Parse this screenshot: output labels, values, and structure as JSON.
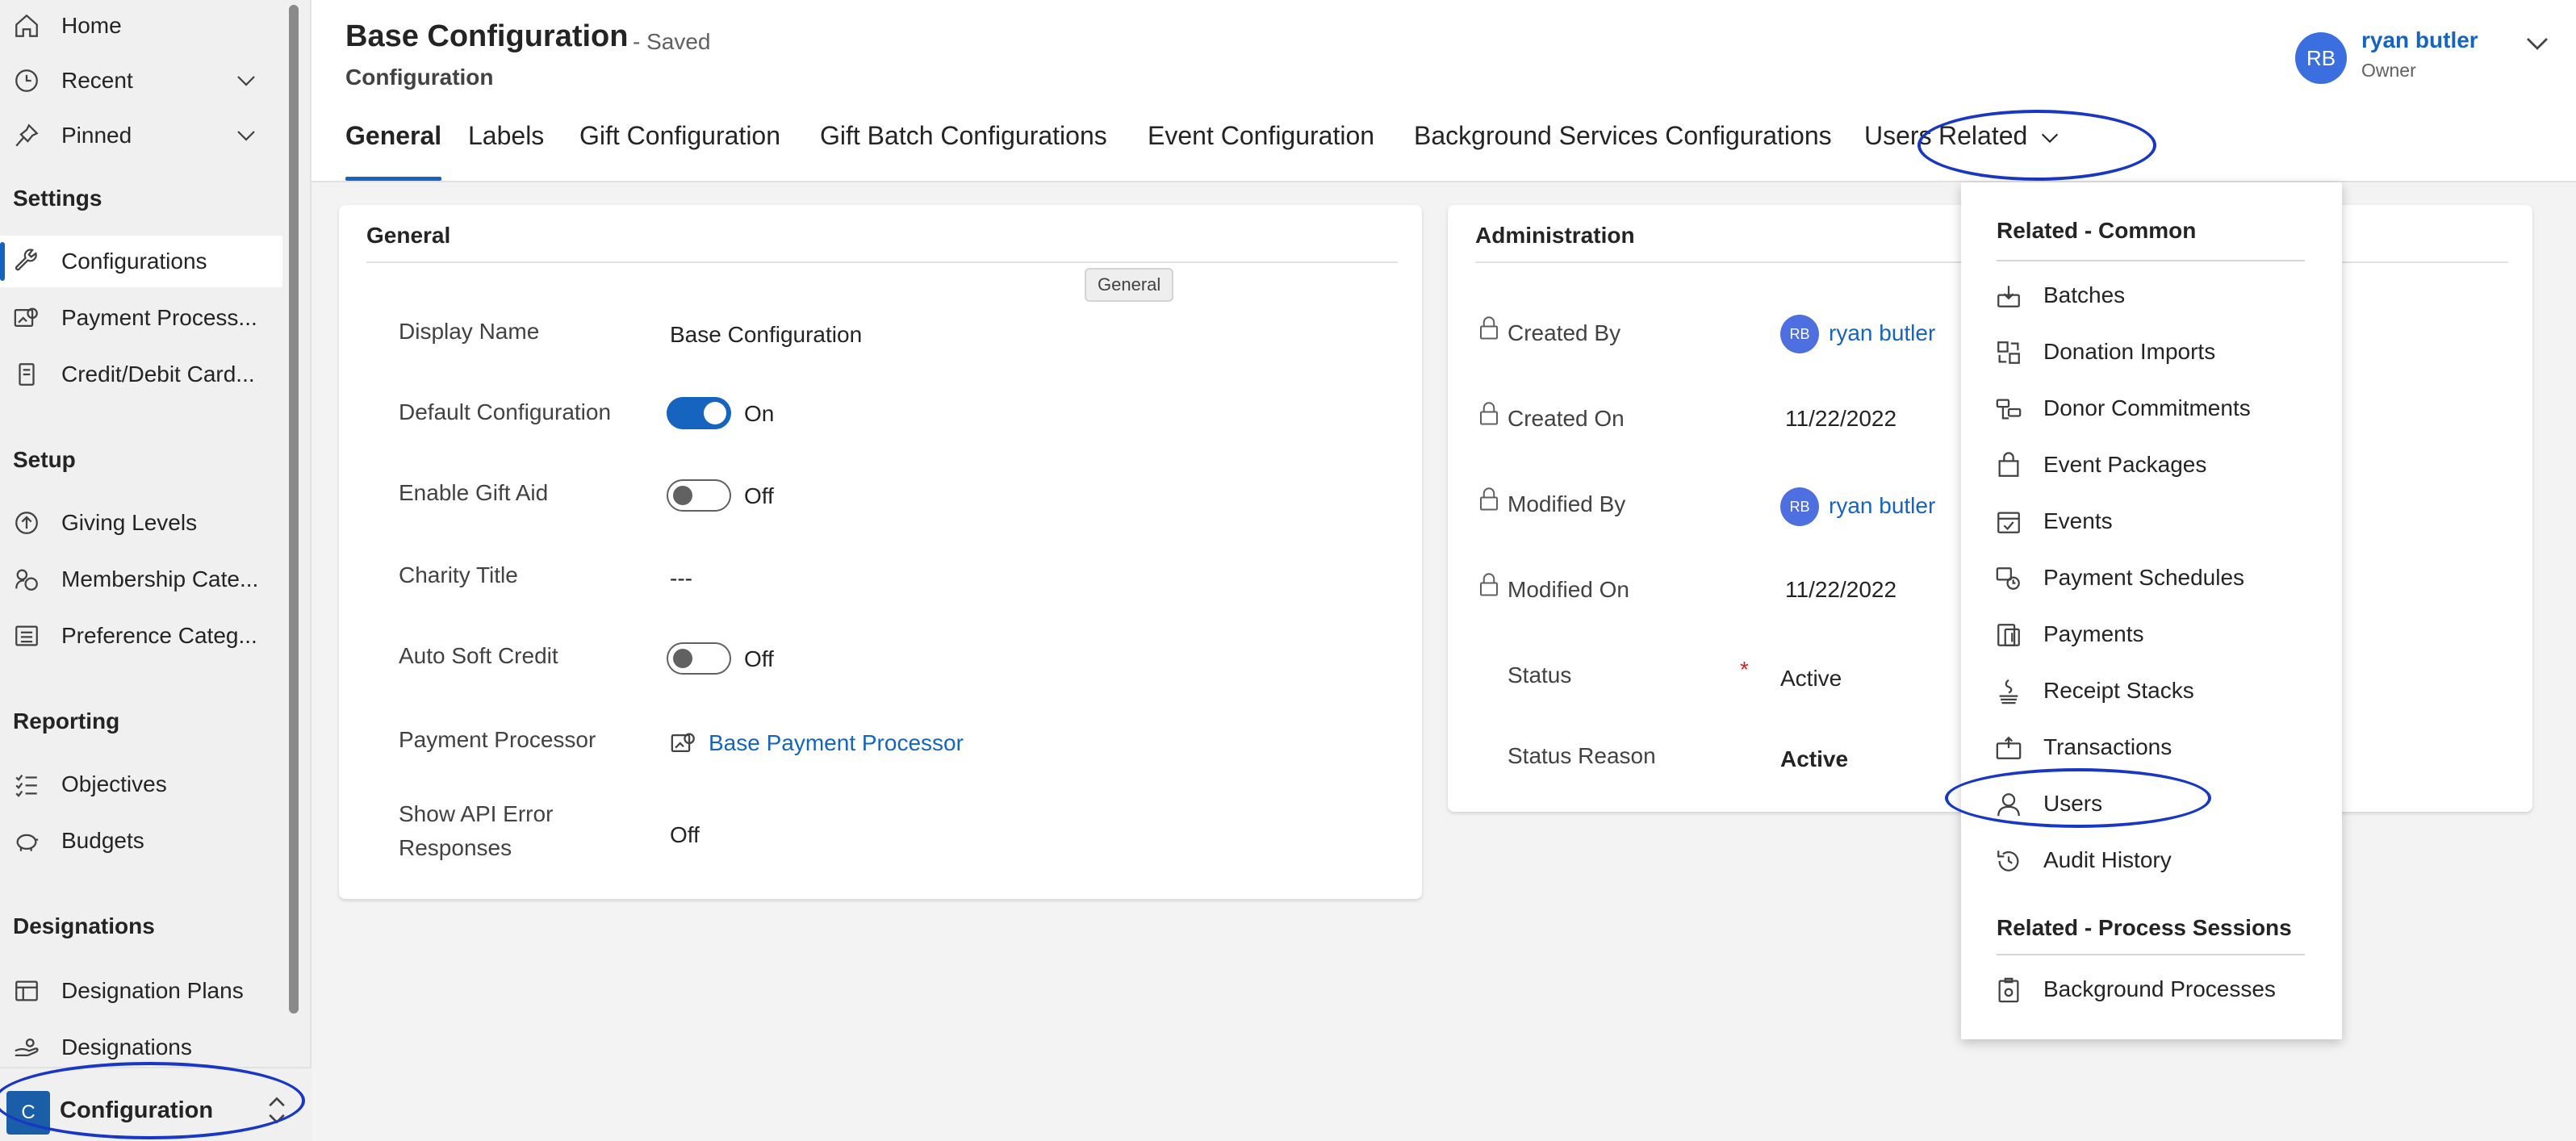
{
  "sidebar": {
    "items": [
      {
        "label": "Home",
        "icon": "home-icon"
      },
      {
        "label": "Recent",
        "icon": "clock-icon"
      },
      {
        "label": "Pinned",
        "icon": "pin-icon"
      }
    ],
    "sections": [
      {
        "title": "Settings",
        "items": [
          {
            "label": "Configurations",
            "icon": "wrench-icon",
            "active": true
          },
          {
            "label": "Payment Process...",
            "icon": "payment-processor-icon"
          },
          {
            "label": "Credit/Debit Card...",
            "icon": "card-document-icon"
          }
        ]
      },
      {
        "title": "Setup",
        "items": [
          {
            "label": "Giving Levels",
            "icon": "arrow-up-circle-icon"
          },
          {
            "label": "Membership Cate...",
            "icon": "membership-icon"
          },
          {
            "label": "Preference Categ...",
            "icon": "list-icon"
          }
        ]
      },
      {
        "title": "Reporting",
        "items": [
          {
            "label": "Objectives",
            "icon": "checklist-icon"
          },
          {
            "label": "Budgets",
            "icon": "piggy-bank-icon"
          }
        ]
      },
      {
        "title": "Designations",
        "items": [
          {
            "label": "Designation Plans",
            "icon": "table-icon"
          },
          {
            "label": "Designations",
            "icon": "hand-coin-icon"
          }
        ]
      }
    ],
    "area": {
      "badge": "C",
      "label": "Configuration"
    }
  },
  "header": {
    "title": "Base Configuration",
    "saved": "- Saved",
    "subtitle": "Configuration",
    "owner": {
      "initials": "RB",
      "name": "ryan butler",
      "role": "Owner"
    }
  },
  "tabs": [
    {
      "label": "General",
      "active": true
    },
    {
      "label": "Labels"
    },
    {
      "label": "Gift Configuration"
    },
    {
      "label": "Gift Batch Configurations"
    },
    {
      "label": "Event Configuration"
    },
    {
      "label": "Background Services Configurations"
    },
    {
      "label": "Users"
    },
    {
      "label": "Related"
    }
  ],
  "tooltip": "General",
  "general": {
    "title": "General",
    "display_name_label": "Display Name",
    "display_name": "Base Configuration",
    "default_config_label": "Default Configuration",
    "default_config_state": "On",
    "gift_aid_label": "Enable Gift Aid",
    "gift_aid_state": "Off",
    "charity_title_label": "Charity Title",
    "charity_title": "---",
    "auto_soft_credit_label": "Auto Soft Credit",
    "auto_soft_credit_state": "Off",
    "payment_processor_label": "Payment Processor",
    "payment_processor": "Base Payment Processor",
    "api_errors_label_1": "Show API Error",
    "api_errors_label_2": "Responses",
    "api_errors": "Off"
  },
  "admin": {
    "title": "Administration",
    "created_by_label": "Created By",
    "created_by_initials": "RB",
    "created_by": "ryan butler",
    "created_on_label": "Created On",
    "created_on": "11/22/2022",
    "modified_by_label": "Modified By",
    "modified_by_initials": "RB",
    "modified_by": "ryan butler",
    "modified_on_label": "Modified On",
    "modified_on": "11/22/2022",
    "status_label": "Status",
    "required_marker": "*",
    "status": "Active",
    "status_reason_label": "Status Reason",
    "status_reason": "Active"
  },
  "related_menu": {
    "common_title": "Related - Common",
    "common_items": [
      {
        "label": "Batches",
        "icon": "batches-icon"
      },
      {
        "label": "Donation Imports",
        "icon": "donation-imports-icon"
      },
      {
        "label": "Donor Commitments",
        "icon": "donor-commitments-icon"
      },
      {
        "label": "Event Packages",
        "icon": "shopping-bag-icon"
      },
      {
        "label": "Events",
        "icon": "calendar-check-icon"
      },
      {
        "label": "Payment Schedules",
        "icon": "payment-schedules-icon"
      },
      {
        "label": "Payments",
        "icon": "payments-icon"
      },
      {
        "label": "Receipt Stacks",
        "icon": "receipt-stacks-icon"
      },
      {
        "label": "Transactions",
        "icon": "transactions-icon"
      },
      {
        "label": "Users",
        "icon": "person-icon"
      },
      {
        "label": "Audit History",
        "icon": "history-icon"
      }
    ],
    "process_title": "Related - Process Sessions",
    "process_items": [
      {
        "label": "Background Processes",
        "icon": "background-process-icon"
      }
    ]
  },
  "colors": {
    "accent": "#1565c0",
    "annotation": "#1837c4",
    "avatar": "#3b6fe0",
    "area_badge": "#1a5ea8"
  }
}
